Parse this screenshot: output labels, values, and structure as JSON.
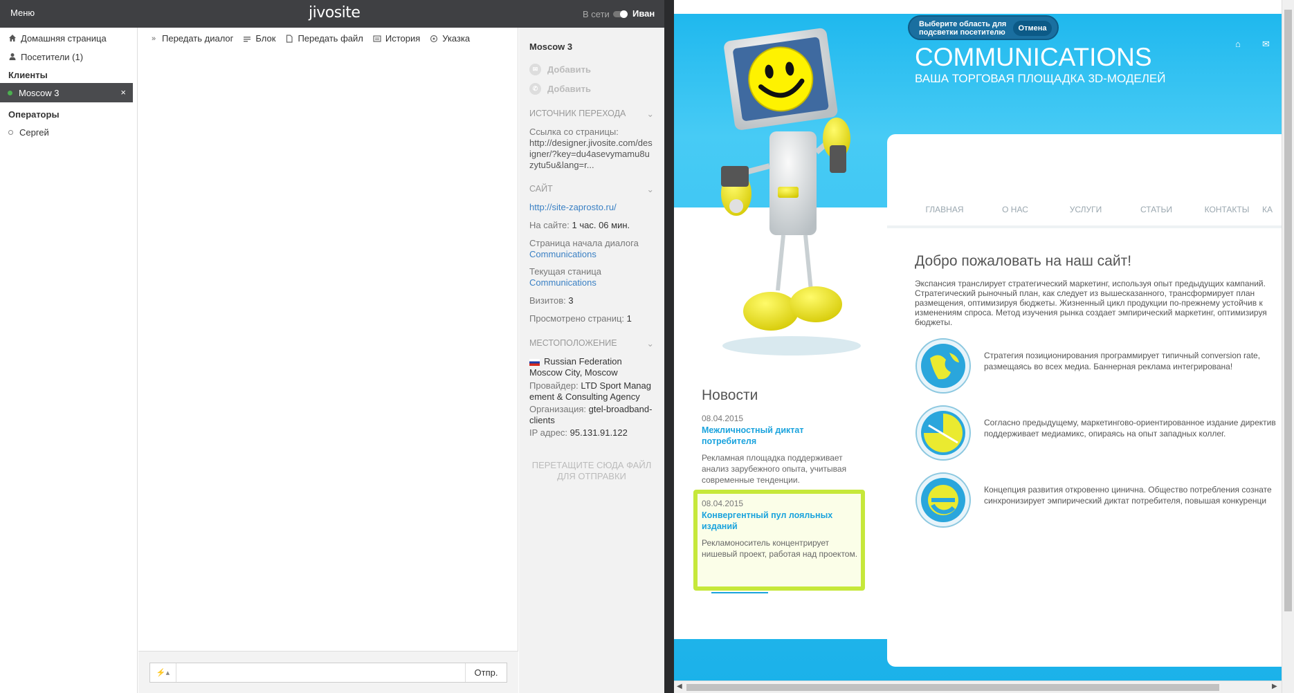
{
  "topbar": {
    "menu": "Меню",
    "logo": "jivosite",
    "status": "В сети",
    "user": "Иван"
  },
  "sidebar": {
    "home": "Домашняя страница",
    "visitors": "Посетители (1)",
    "clients_heading": "Клиенты",
    "active_client": "Moscow 3",
    "close_glyph": "×",
    "operators_heading": "Операторы",
    "operator": "Сергей"
  },
  "toolbar": {
    "transfer": "Передать диалог",
    "block": "Блок",
    "send_file": "Передать файл",
    "history": "История",
    "pointer": "Указка"
  },
  "input": {
    "send": "Отпр.",
    "placeholder": ""
  },
  "info": {
    "name": "Moscow 3",
    "add_email": "Добавить",
    "add_phone": "Добавить",
    "source_heading": "ИСТОЧНИК ПЕРЕХОДА",
    "source_label": "Ссылка со страницы:",
    "source_url": "http://designer.jivosite.com/designer/?key=du4asevymamu8uzytu5u&lang=r...",
    "site_heading": "САЙТ",
    "site_url": "http://site-zaprosto.ru/",
    "on_site_label": "На сайте:",
    "on_site_value": "1 час. 06 мин.",
    "start_page_label": "Страница начала диалога",
    "start_page_value": "Communications",
    "current_page_label": "Текущая станица",
    "current_page_value": "Communications",
    "visits_label": "Визитов:",
    "visits_value": "3",
    "pages_label": "Просмотрено страниц:",
    "pages_value": "1",
    "location_heading": "МЕСТОПОЛОЖЕНИЕ",
    "country": "Russian Federation",
    "city": "Moscow City, Moscow",
    "provider_label": "Провайдер:",
    "provider_value": "LTD Sport Management & Consulting Agency",
    "org_label": "Организация:",
    "org_value": "gtel-broadband-clients",
    "ip_label": "IP адрес:",
    "ip_value": "95.131.91.122",
    "drop_hint": "ПЕРЕТАЩИТЕ СЮДА ФАЙЛ ДЛЯ ОТПРАВКИ"
  },
  "site": {
    "tip_text": "Выберите область для подсветки посетителю",
    "tip_cancel": "Отмена",
    "title": "COMMUNICATIONS",
    "subtitle": "ВАША ТОРГОВАЯ ПЛОЩАДКА 3D-МОДЕЛЕЙ",
    "nav": [
      "ГЛАВНАЯ",
      "О НАС",
      "УСЛУГИ",
      "СТАТЬИ",
      "КОНТАКТЫ",
      "КА"
    ],
    "welcome": "Добро пожаловать на наш сайт!",
    "welcome_text": "Экспансия транслирует стратегический маркетинг, используя опыт предыдущих кампаний. Стратегический рыночный план, как следует из вышесказанного, трансформирует план размещения, оптимизируя бюджеты. Жизненный цикл продукции по-прежнему устойчив к изменениям спроса. Метод изучения рынка создает эмпирический маркетинг, оптимизируя бюджеты.",
    "features": [
      "Стратегия позиционирования программирует типичный conversion rate, размещаясь во всех медиа. Баннерная реклама интегрирована!",
      "Согласно предыдущему, маркетингово-ориентированное издание директив поддерживает медиамикс, опираясь на опыт западных коллег.",
      "Концепция развития откровенно цинична. Общество потребления сознате синхронизирует эмпирический диктат потребителя, повышая конкуренци"
    ],
    "news_heading": "Новости",
    "news": [
      {
        "date": "08.04.2015",
        "title": "Межличностный диктат потребителя",
        "text": "Рекламная площадка поддерживает анализ зарубежного опыта, учитывая современные тенденции."
      },
      {
        "date": "08.04.2015",
        "title": "Конвергентный пул лояльных изданий",
        "text": "Рекламоноситель концентрирует нишевый проект, работая над проектом."
      }
    ]
  }
}
